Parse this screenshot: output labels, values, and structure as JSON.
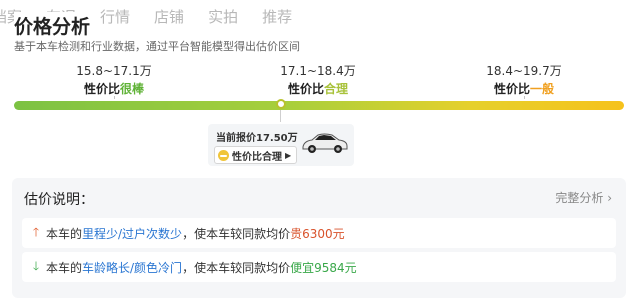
{
  "nav": {
    "tabs": [
      "档案",
      "车况",
      "行情",
      "店铺",
      "实拍",
      "推荐"
    ]
  },
  "header": {
    "title": "价格分析",
    "subtitle": "基于本车检测和行业数据，通过平台智能模型得出估价区间"
  },
  "ranges": [
    {
      "value": "15.8~17.1万",
      "prefix": "性价比",
      "rating": "很棒"
    },
    {
      "value": "17.1~18.4万",
      "prefix": "性价比",
      "rating": "合理"
    },
    {
      "value": "18.4~19.7万",
      "prefix": "性价比",
      "rating": "一般"
    }
  ],
  "current": {
    "label": "当前报价17.50万",
    "tag": "性价比合理",
    "icon": "smile-icon",
    "level_fraction": 0.43
  },
  "colors": {
    "green": "#7cc243",
    "yellow": "#f6c21c",
    "up": "#e05a2b",
    "down": "#3aa84a"
  },
  "explain": {
    "title": "估价说明：",
    "more": "完整分析",
    "rows": [
      {
        "icon": "arrow-up-icon",
        "pre": "本车的",
        "hl": "里程少/过户次数少",
        "mid": "，使本车较同款均价",
        "val": "贵6300元"
      },
      {
        "icon": "arrow-down-icon",
        "pre": "本车的",
        "hl": "车龄略长/颜色冷门",
        "mid": "，使本车较同款均价",
        "val": "便宜9584元"
      }
    ]
  }
}
